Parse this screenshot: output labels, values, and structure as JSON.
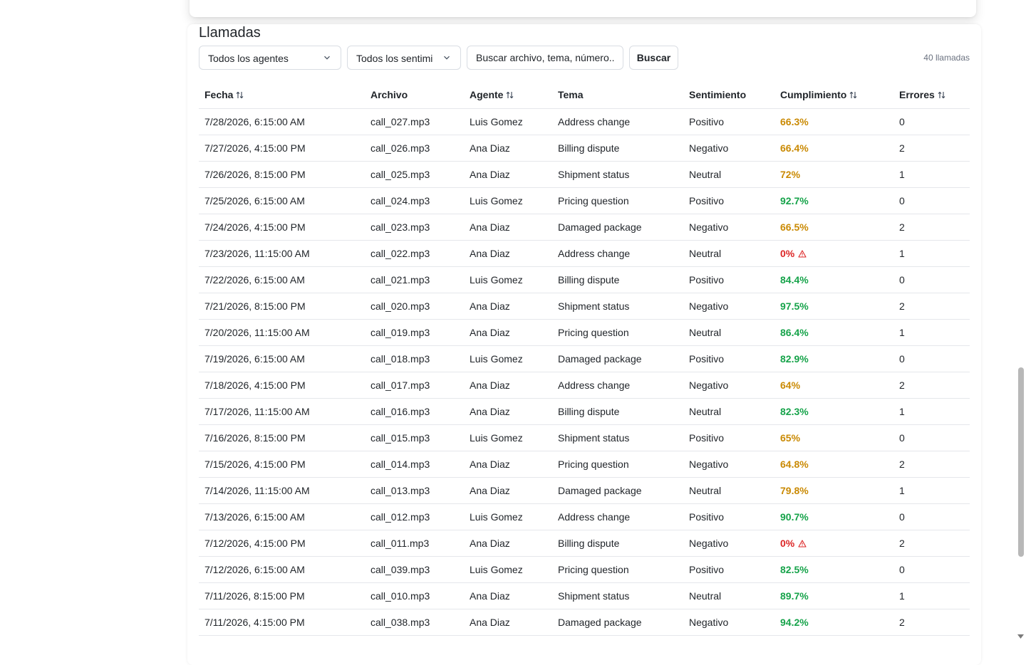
{
  "section": {
    "title": "Llamadas",
    "count": "40 llamadas"
  },
  "filters": {
    "agent_select": "Todos los agentes",
    "sentiment_select": "Todos los sentimi",
    "search_placeholder": "Buscar archivo, tema, número...",
    "search_button": "Buscar"
  },
  "table": {
    "columns": [
      "Fecha",
      "Archivo",
      "Agente",
      "Tema",
      "Sentimiento",
      "Cumplimiento",
      "Errores"
    ],
    "sortable": [
      true,
      false,
      true,
      false,
      false,
      true,
      true
    ],
    "rows": [
      {
        "fecha": "7/28/2026, 6:15:00 AM",
        "archivo": "call_027.mp3",
        "agente": "Luis Gomez",
        "tema": "Address change",
        "sentimiento": "Positivo",
        "cumplimiento": "66.3%",
        "level": "amber",
        "alert": false,
        "errores": "0"
      },
      {
        "fecha": "7/27/2026, 4:15:00 PM",
        "archivo": "call_026.mp3",
        "agente": "Ana Diaz",
        "tema": "Billing dispute",
        "sentimiento": "Negativo",
        "cumplimiento": "66.4%",
        "level": "amber",
        "alert": false,
        "errores": "2"
      },
      {
        "fecha": "7/26/2026, 8:15:00 PM",
        "archivo": "call_025.mp3",
        "agente": "Ana Diaz",
        "tema": "Shipment status",
        "sentimiento": "Neutral",
        "cumplimiento": "72%",
        "level": "amber",
        "alert": false,
        "errores": "1"
      },
      {
        "fecha": "7/25/2026, 6:15:00 AM",
        "archivo": "call_024.mp3",
        "agente": "Luis Gomez",
        "tema": "Pricing question",
        "sentimiento": "Positivo",
        "cumplimiento": "92.7%",
        "level": "green",
        "alert": false,
        "errores": "0"
      },
      {
        "fecha": "7/24/2026, 4:15:00 PM",
        "archivo": "call_023.mp3",
        "agente": "Ana Diaz",
        "tema": "Damaged package",
        "sentimiento": "Negativo",
        "cumplimiento": "66.5%",
        "level": "amber",
        "alert": false,
        "errores": "2"
      },
      {
        "fecha": "7/23/2026, 11:15:00 AM",
        "archivo": "call_022.mp3",
        "agente": "Ana Diaz",
        "tema": "Address change",
        "sentimiento": "Neutral",
        "cumplimiento": "0%",
        "level": "red",
        "alert": true,
        "errores": "1"
      },
      {
        "fecha": "7/22/2026, 6:15:00 AM",
        "archivo": "call_021.mp3",
        "agente": "Luis Gomez",
        "tema": "Billing dispute",
        "sentimiento": "Positivo",
        "cumplimiento": "84.4%",
        "level": "green",
        "alert": false,
        "errores": "0"
      },
      {
        "fecha": "7/21/2026, 8:15:00 PM",
        "archivo": "call_020.mp3",
        "agente": "Ana Diaz",
        "tema": "Shipment status",
        "sentimiento": "Negativo",
        "cumplimiento": "97.5%",
        "level": "green",
        "alert": false,
        "errores": "2"
      },
      {
        "fecha": "7/20/2026, 11:15:00 AM",
        "archivo": "call_019.mp3",
        "agente": "Ana Diaz",
        "tema": "Pricing question",
        "sentimiento": "Neutral",
        "cumplimiento": "86.4%",
        "level": "green",
        "alert": false,
        "errores": "1"
      },
      {
        "fecha": "7/19/2026, 6:15:00 AM",
        "archivo": "call_018.mp3",
        "agente": "Luis Gomez",
        "tema": "Damaged package",
        "sentimiento": "Positivo",
        "cumplimiento": "82.9%",
        "level": "green",
        "alert": false,
        "errores": "0"
      },
      {
        "fecha": "7/18/2026, 4:15:00 PM",
        "archivo": "call_017.mp3",
        "agente": "Ana Diaz",
        "tema": "Address change",
        "sentimiento": "Negativo",
        "cumplimiento": "64%",
        "level": "amber",
        "alert": false,
        "errores": "2"
      },
      {
        "fecha": "7/17/2026, 11:15:00 AM",
        "archivo": "call_016.mp3",
        "agente": "Ana Diaz",
        "tema": "Billing dispute",
        "sentimiento": "Neutral",
        "cumplimiento": "82.3%",
        "level": "green",
        "alert": false,
        "errores": "1"
      },
      {
        "fecha": "7/16/2026, 8:15:00 PM",
        "archivo": "call_015.mp3",
        "agente": "Luis Gomez",
        "tema": "Shipment status",
        "sentimiento": "Positivo",
        "cumplimiento": "65%",
        "level": "amber",
        "alert": false,
        "errores": "0"
      },
      {
        "fecha": "7/15/2026, 4:15:00 PM",
        "archivo": "call_014.mp3",
        "agente": "Ana Diaz",
        "tema": "Pricing question",
        "sentimiento": "Negativo",
        "cumplimiento": "64.8%",
        "level": "amber",
        "alert": false,
        "errores": "2"
      },
      {
        "fecha": "7/14/2026, 11:15:00 AM",
        "archivo": "call_013.mp3",
        "agente": "Ana Diaz",
        "tema": "Damaged package",
        "sentimiento": "Neutral",
        "cumplimiento": "79.8%",
        "level": "amber",
        "alert": false,
        "errores": "1"
      },
      {
        "fecha": "7/13/2026, 6:15:00 AM",
        "archivo": "call_012.mp3",
        "agente": "Luis Gomez",
        "tema": "Address change",
        "sentimiento": "Positivo",
        "cumplimiento": "90.7%",
        "level": "green",
        "alert": false,
        "errores": "0"
      },
      {
        "fecha": "7/12/2026, 4:15:00 PM",
        "archivo": "call_011.mp3",
        "agente": "Ana Diaz",
        "tema": "Billing dispute",
        "sentimiento": "Negativo",
        "cumplimiento": "0%",
        "level": "red",
        "alert": true,
        "errores": "2"
      },
      {
        "fecha": "7/12/2026, 6:15:00 AM",
        "archivo": "call_039.mp3",
        "agente": "Luis Gomez",
        "tema": "Pricing question",
        "sentimiento": "Positivo",
        "cumplimiento": "82.5%",
        "level": "green",
        "alert": false,
        "errores": "0"
      },
      {
        "fecha": "7/11/2026, 8:15:00 PM",
        "archivo": "call_010.mp3",
        "agente": "Ana Diaz",
        "tema": "Shipment status",
        "sentimiento": "Neutral",
        "cumplimiento": "89.7%",
        "level": "green",
        "alert": false,
        "errores": "1"
      },
      {
        "fecha": "7/11/2026, 4:15:00 PM",
        "archivo": "call_038.mp3",
        "agente": "Ana Diaz",
        "tema": "Damaged package",
        "sentimiento": "Negativo",
        "cumplimiento": "94.2%",
        "level": "green",
        "alert": false,
        "errores": "2"
      }
    ]
  },
  "colors": {
    "green": "#16a34a",
    "amber": "#ca8a04",
    "red": "#dc2626"
  },
  "icons": {
    "sort": "sort-arrows-icon",
    "alert": "warning-triangle-icon",
    "dropdown": "chevron-down-icon"
  }
}
